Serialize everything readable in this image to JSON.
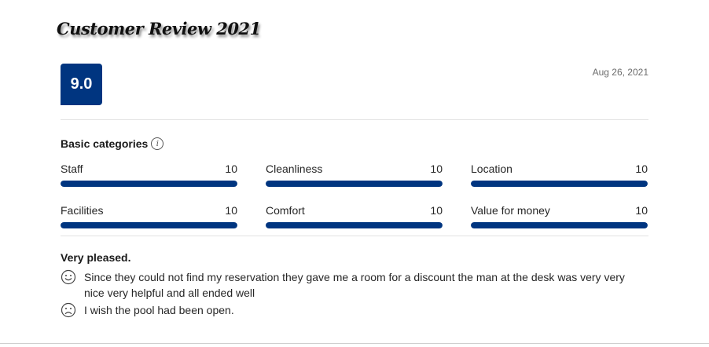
{
  "page": {
    "title": "Customer Review 2021"
  },
  "review": {
    "score": "9.0",
    "date": "Aug 26, 2021",
    "title": "Very pleased.",
    "positive": "Since they could not find my reservation they gave me a room for a discount the man at the desk was very very nice very helpful and all ended well",
    "negative": "I wish the pool had been open."
  },
  "categories": {
    "heading": "Basic categories",
    "info_icon": "info-icon",
    "items": [
      {
        "label": "Staff",
        "score": "10",
        "fill_fraction": 1.0
      },
      {
        "label": "Cleanliness",
        "score": "10",
        "fill_fraction": 1.0
      },
      {
        "label": "Location",
        "score": "10",
        "fill_fraction": 1.0
      },
      {
        "label": "Facilities",
        "score": "10",
        "fill_fraction": 1.0
      },
      {
        "label": "Comfort",
        "score": "10",
        "fill_fraction": 1.0
      },
      {
        "label": "Value for money",
        "score": "10",
        "fill_fraction": 1.0
      }
    ]
  },
  "icons": {
    "positive": "smiley-face-icon",
    "negative": "sad-face-icon"
  },
  "colors": {
    "brand": "#003580",
    "track": "#e6e6e6"
  }
}
